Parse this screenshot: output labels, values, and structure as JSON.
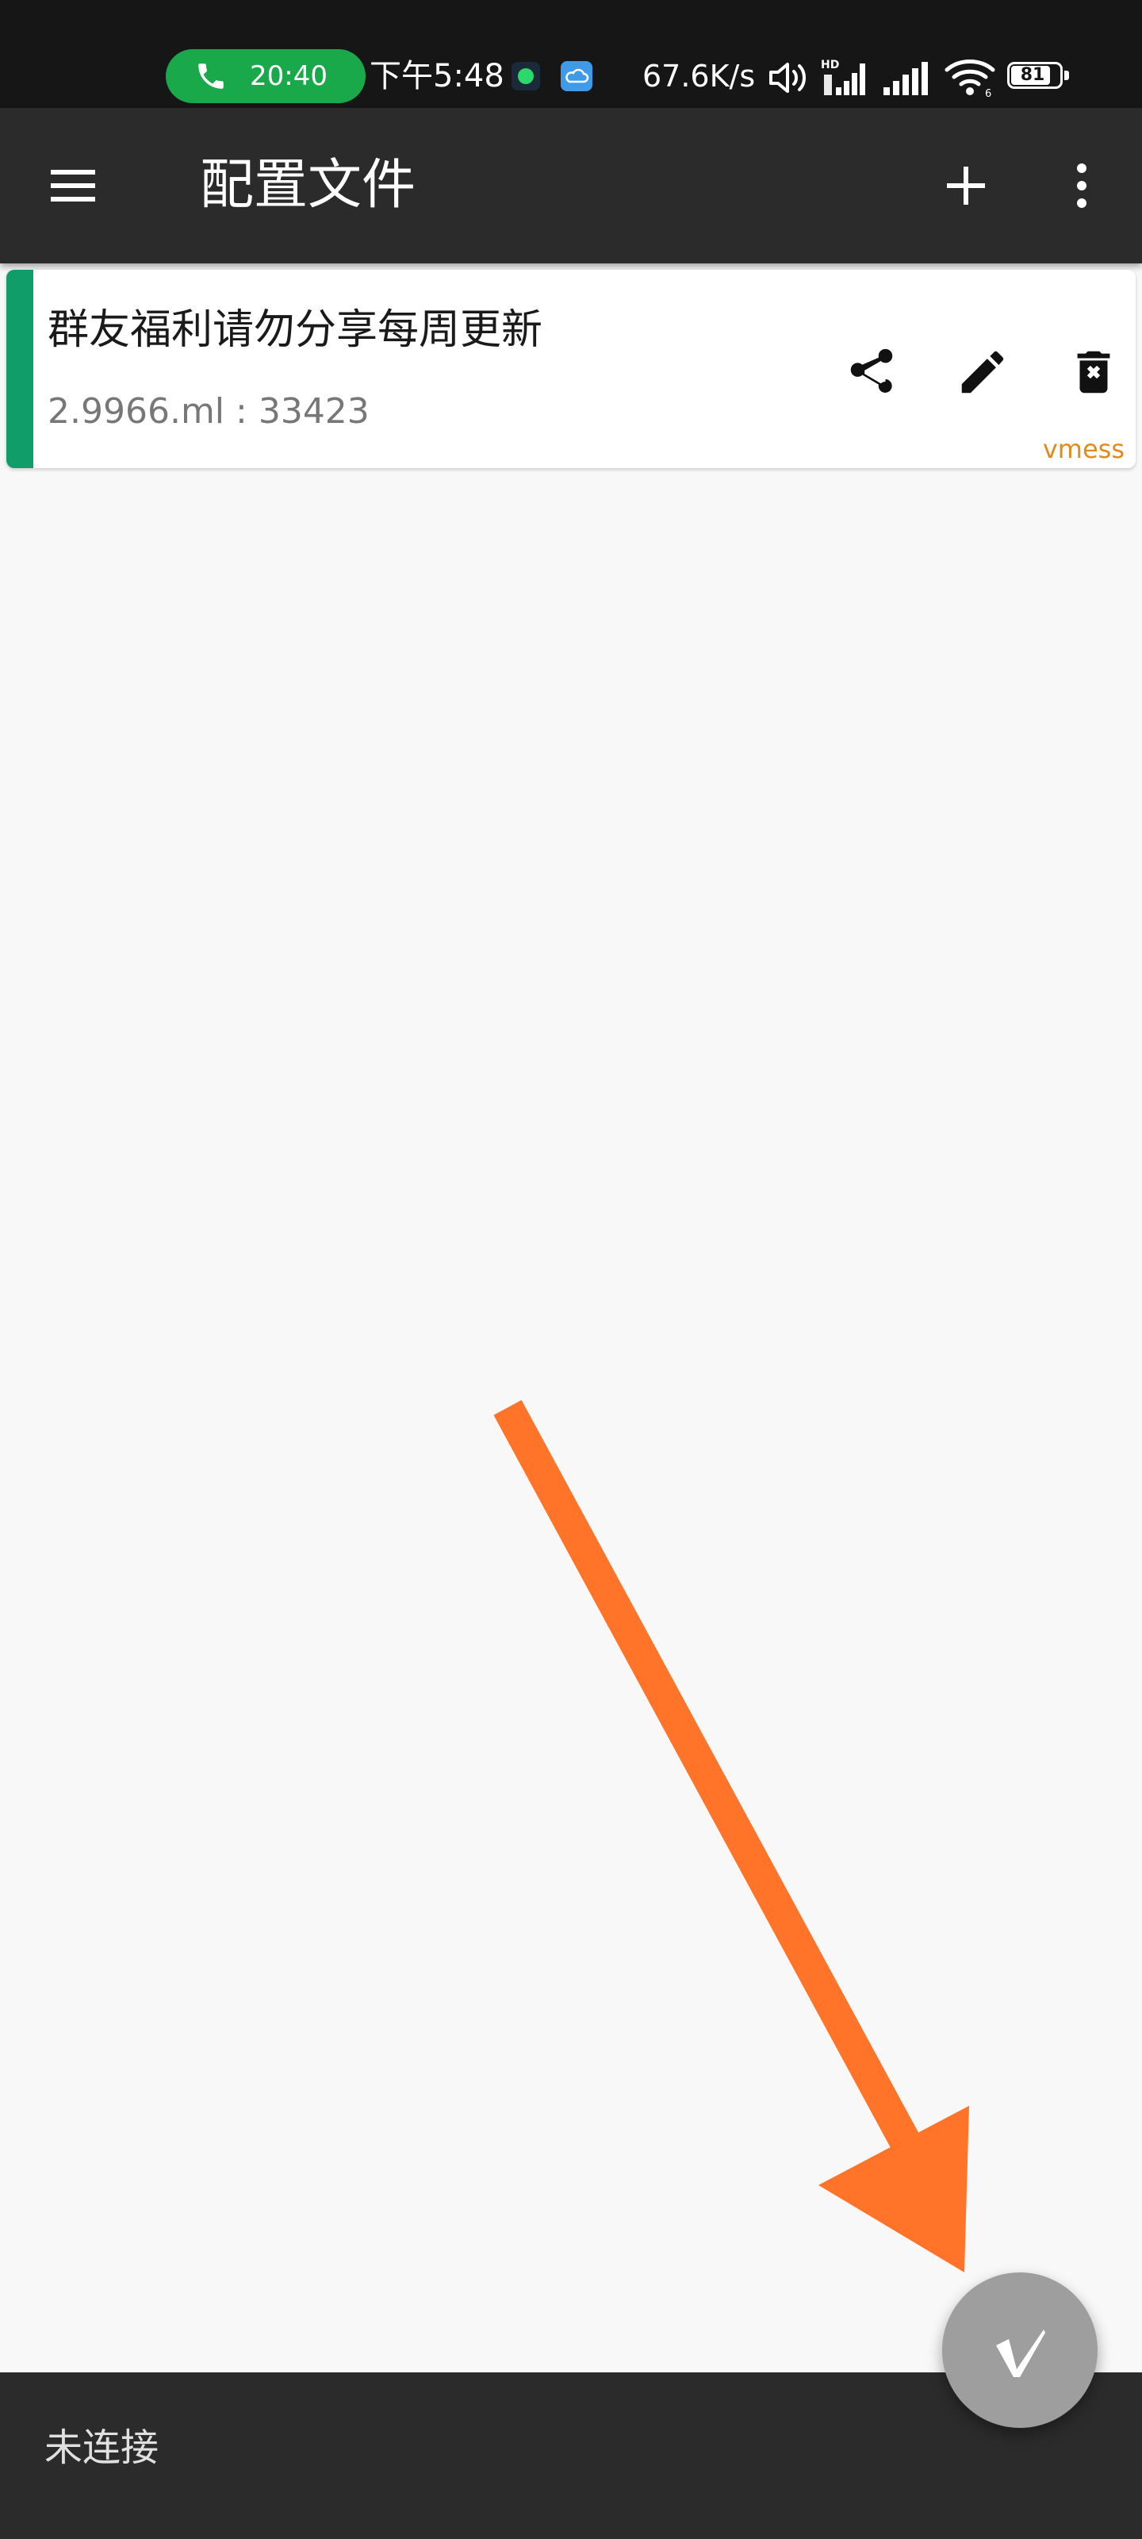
{
  "status_bar": {
    "call_time": "20:40",
    "clock": "下午5:48",
    "network_speed": "67.6K/s",
    "battery_level": "81",
    "call_pill_color": "#1aa94a",
    "icons": [
      "phone-icon",
      "notification-app-icon",
      "weather-cloud-icon",
      "volume-icon",
      "signal-hd-icon",
      "signal-icon",
      "wifi-icon",
      "battery-icon"
    ]
  },
  "toolbar": {
    "title": "配置文件",
    "background": "#2b2b2b",
    "icons": [
      "menu-icon",
      "plus-icon",
      "more-vert-icon"
    ]
  },
  "servers": [
    {
      "name": "群友福利请勿分享每周更新",
      "address": "2.9966.ml : 33423",
      "protocol": "vmess",
      "selected": true,
      "accent_color": "#0f9d6a",
      "protocol_color": "#e28b1b",
      "actions": [
        "share-icon",
        "edit-pencil-icon",
        "delete-icon"
      ]
    }
  ],
  "annotation": {
    "type": "arrow",
    "color": "#ff7428",
    "points_to": "connect-fab"
  },
  "bottom_bar": {
    "status_text": "未连接"
  },
  "fab": {
    "icon": "v-logo-icon",
    "state": "disconnected",
    "color": "#9e9e9e"
  }
}
